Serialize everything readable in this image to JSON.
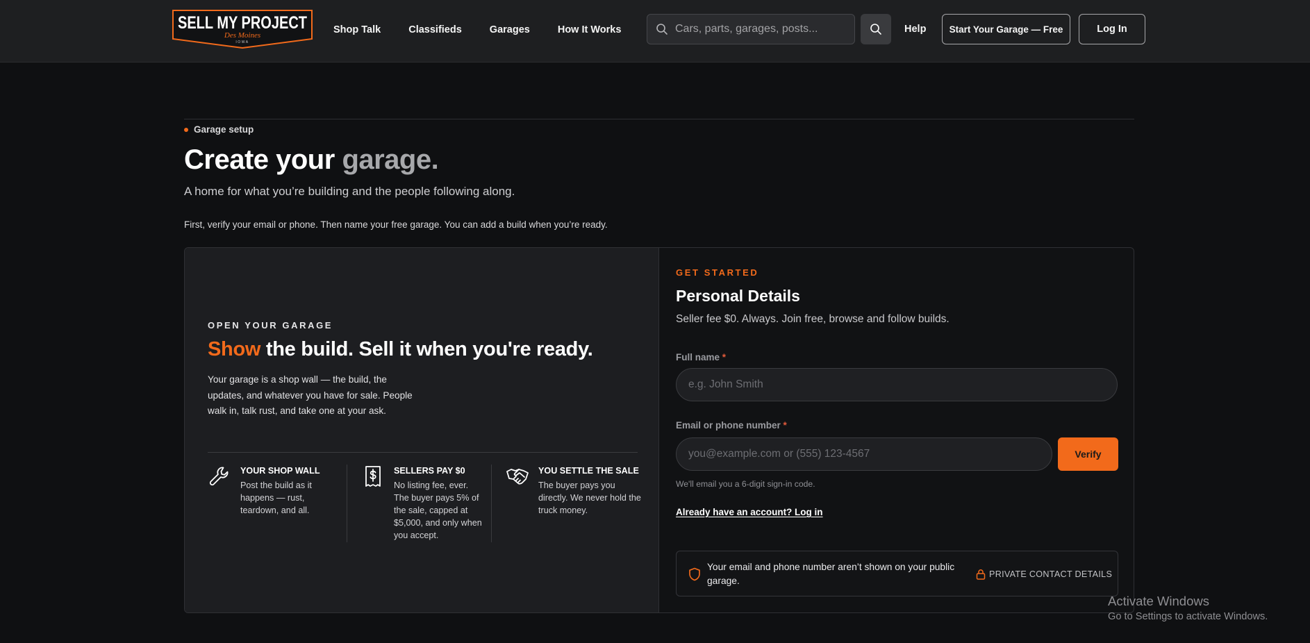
{
  "header": {
    "logo": {
      "main": "SELL MY PROJECT",
      "sub": "Des Moines",
      "tiny": "IOWA"
    },
    "nav": [
      {
        "label": "Shop Talk"
      },
      {
        "label": "Classifieds"
      },
      {
        "label": "Garages"
      },
      {
        "label": "How It Works"
      }
    ],
    "search": {
      "placeholder": "Cars, parts, garages, posts...",
      "value": "",
      "icon": "search-icon"
    },
    "help_label": "Help",
    "start_label": "Start Your Garage — Free",
    "login_label": "Log In"
  },
  "intro": {
    "eyebrow": "Garage setup",
    "title_main": "Create your",
    "title_muted": "garage.",
    "subtitle": "A home for what you’re building and the people following along.",
    "note": "First, verify your email or phone. Then name your free garage. You can add a build when you’re ready."
  },
  "left": {
    "eyebrow": "OPEN YOUR GARAGE",
    "title_accent": "Show",
    "title_rest": " the build. Sell it when you're ready.",
    "description": "Your garage is a shop wall — the build, the updates, and whatever you have for sale. People walk in, talk rust, and take one at your ask.",
    "features": [
      {
        "icon": "wrench-icon",
        "title": "YOUR SHOP WALL",
        "desc": "Post the build as it happens — rust, teardown, and all."
      },
      {
        "icon": "dollar-receipt-icon",
        "title": "SELLERS PAY $0",
        "desc": "No listing fee, ever. The buyer pays 5% of the sale, capped at $5,000, and only when you accept."
      },
      {
        "icon": "handshake-icon",
        "title": "YOU SETTLE THE SALE",
        "desc": "The buyer pays you directly. We never hold the truck money."
      }
    ]
  },
  "form": {
    "eyebrow": "GET STARTED",
    "title": "Personal Details",
    "subtitle": "Seller fee $0. Always. Join free, browse and follow builds.",
    "name_label": "Full name",
    "name_placeholder": "e.g. John Smith",
    "contact_label": "Email or phone number",
    "contact_placeholder": "you@example.com or (555) 123-4567",
    "required_mark": "*",
    "verify_label": "Verify",
    "hint": "We'll email you a 6-digit sign-in code.",
    "login_link": "Already have an account? Log in",
    "privacy_text": "Your email and phone number aren’t shown on your public garage.",
    "privacy_tag": "PRIVATE CONTACT DETAILS"
  },
  "watermark": {
    "line1": "Activate Windows",
    "line2": "Go to Settings to activate Windows."
  },
  "colors": {
    "accent": "#f26a1b",
    "background": "#0f1012",
    "header": "#1e1f21",
    "panel": "#1d1e21",
    "required": "#e25a3b"
  }
}
